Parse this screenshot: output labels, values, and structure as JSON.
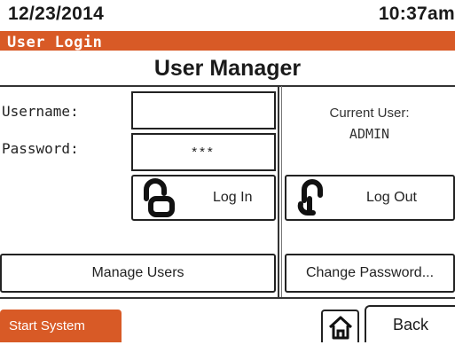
{
  "status_bar": {
    "date": "12/23/2014",
    "time": "10:37am"
  },
  "title_bar": {
    "title": "User Login"
  },
  "header": {
    "title": "User Manager"
  },
  "login_form": {
    "username_label": "Username:",
    "username_value": "",
    "password_label": "Password:",
    "password_value": "***"
  },
  "current_user": {
    "label": "Current User:",
    "value": "ADMIN"
  },
  "buttons": {
    "log_in": "Log In",
    "log_out": "Log Out",
    "manage_users": "Manage Users",
    "change_password": "Change Password..."
  },
  "footer": {
    "start_system": "Start System",
    "back": "Back"
  },
  "icons": {
    "login": "lock-icon",
    "logout": "lock-icon",
    "home": "home-icon"
  },
  "colors": {
    "accent": "#d85a26",
    "border": "#222222"
  }
}
